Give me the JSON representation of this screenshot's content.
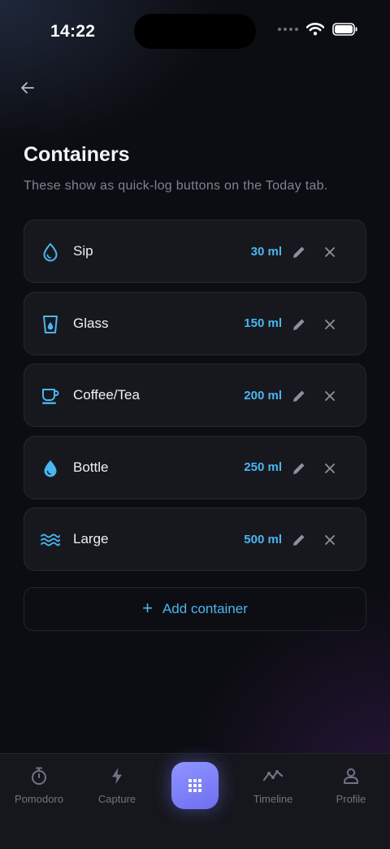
{
  "status_bar": {
    "time": "14:22",
    "icons": [
      "signal-dots-icon",
      "wifi-icon",
      "battery-icon"
    ]
  },
  "header": {
    "back_icon": "arrow-left-icon",
    "title": "Containers",
    "subtitle": "These show as quick-log buttons on the Today tab."
  },
  "containers": [
    {
      "icon": "droplet-outline-icon",
      "label": "Sip",
      "amount": "30 ml"
    },
    {
      "icon": "glass-icon",
      "label": "Glass",
      "amount": "150 ml"
    },
    {
      "icon": "coffee-cup-icon",
      "label": "Coffee/Tea",
      "amount": "200 ml"
    },
    {
      "icon": "droplet-filled-icon",
      "label": "Bottle",
      "amount": "250 ml"
    },
    {
      "icon": "waves-icon",
      "label": "Large",
      "amount": "500 ml"
    }
  ],
  "add_button": {
    "icon": "plus-icon",
    "label": "Add container"
  },
  "tab_bar": {
    "tabs": [
      {
        "icon": "stopwatch-icon",
        "label": "Pomodoro"
      },
      {
        "icon": "bolt-icon",
        "label": "Capture"
      },
      {
        "icon": "grid-icon",
        "label": ""
      },
      {
        "icon": "trend-line-icon",
        "label": "Timeline"
      },
      {
        "icon": "user-icon",
        "label": "Profile"
      }
    ]
  },
  "colors": {
    "background": "#0c0d12",
    "card": "#17181e",
    "accent_blue": "#4ab6f0",
    "fab_purple": "#7b7ef7",
    "muted_text": "#7e8394"
  }
}
